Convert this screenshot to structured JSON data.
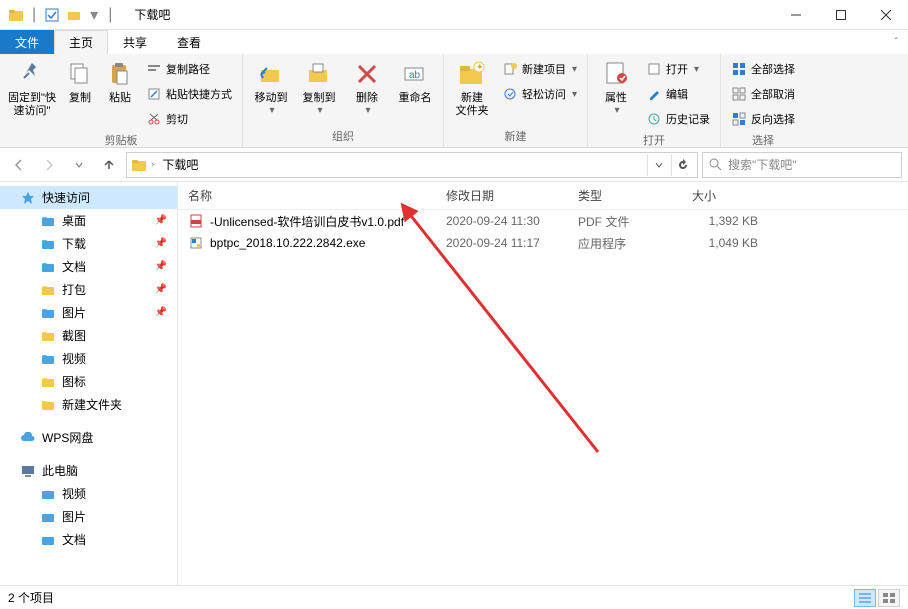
{
  "window": {
    "title": "下载吧"
  },
  "tabs": {
    "file": "文件",
    "home": "主页",
    "share": "共享",
    "view": "查看"
  },
  "ribbon": {
    "clipboard": {
      "pin": "固定到\"快\n速访问\"",
      "copy": "复制",
      "paste": "粘贴",
      "copyPath": "复制路径",
      "pasteShortcut": "粘贴快捷方式",
      "cut": "剪切",
      "group": "剪贴板"
    },
    "organize": {
      "moveTo": "移动到",
      "copyTo": "复制到",
      "delete": "删除",
      "rename": "重命名",
      "group": "组织"
    },
    "new": {
      "newFolder": "新建\n文件夹",
      "newItem": "新建项目",
      "easyAccess": "轻松访问",
      "group": "新建"
    },
    "open": {
      "properties": "属性",
      "open": "打开",
      "edit": "编辑",
      "history": "历史记录",
      "group": "打开"
    },
    "select": {
      "selectAll": "全部选择",
      "selectNone": "全部取消",
      "invert": "反向选择",
      "group": "选择"
    }
  },
  "address": {
    "crumb": "下载吧",
    "searchPlaceholder": "搜索\"下载吧\""
  },
  "sidebar": {
    "quickAccess": "快速访问",
    "items": [
      {
        "label": "桌面",
        "pin": true,
        "color": "#4aa3df"
      },
      {
        "label": "下载",
        "pin": true,
        "color": "#4aa3df"
      },
      {
        "label": "文档",
        "pin": true,
        "color": "#4aa3df"
      },
      {
        "label": "打包",
        "pin": true,
        "color": "#f2c94c"
      },
      {
        "label": "图片",
        "pin": true,
        "color": "#4aa3df"
      },
      {
        "label": "截图",
        "pin": false,
        "color": "#f2c94c"
      },
      {
        "label": "视频",
        "pin": false,
        "color": "#4aa3df"
      },
      {
        "label": "图标",
        "pin": false,
        "color": "#f2c94c"
      },
      {
        "label": "新建文件夹",
        "pin": false,
        "color": "#f2c94c"
      }
    ],
    "wps": "WPS网盘",
    "thisPC": "此电脑",
    "pcItems": [
      {
        "label": "视频"
      },
      {
        "label": "图片"
      },
      {
        "label": "文档"
      }
    ]
  },
  "columns": {
    "name": "名称",
    "date": "修改日期",
    "type": "类型",
    "size": "大小"
  },
  "files": [
    {
      "name": "-Unlicensed-软件培训白皮书v1.0.pdf",
      "date": "2020-09-24 11:30",
      "type": "PDF 文件",
      "size": "1,392 KB",
      "kind": "pdf"
    },
    {
      "name": "bptpc_2018.10.222.2842.exe",
      "date": "2020-09-24 11:17",
      "type": "应用程序",
      "size": "1,049 KB",
      "kind": "exe"
    }
  ],
  "status": {
    "count": "2 个项目"
  }
}
